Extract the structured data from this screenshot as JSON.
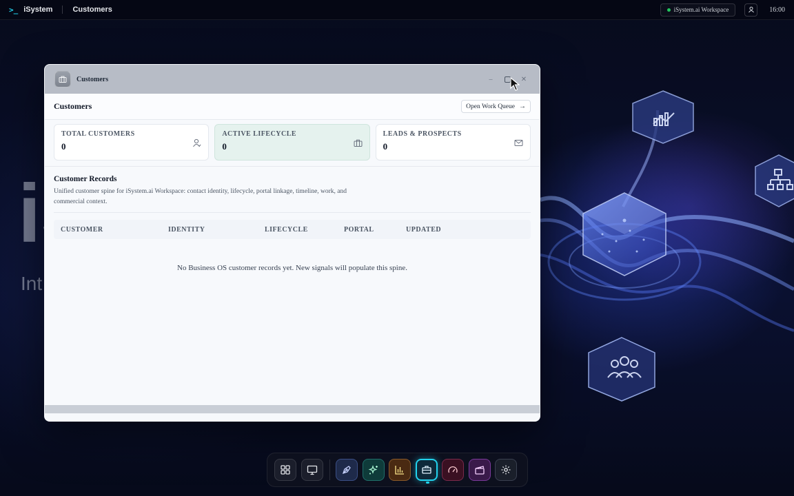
{
  "topbar": {
    "brand": "iSystem",
    "breadcrumb": "Customers",
    "workspace": "iSystem.ai Workspace",
    "clock": "16:00"
  },
  "background": {
    "big_text": "iS",
    "small_text": "Int"
  },
  "window": {
    "title": "Customers",
    "page_title": "Customers",
    "queue_button": "Open Work Queue",
    "stats": [
      {
        "label": "TOTAL CUSTOMERS",
        "value": "0",
        "icon": "user-icon"
      },
      {
        "label": "ACTIVE LIFECYCLE",
        "value": "0",
        "icon": "briefcase-icon"
      },
      {
        "label": "LEADS & PROSPECTS",
        "value": "0",
        "icon": "mail-icon"
      }
    ],
    "records": {
      "title": "Customer Records",
      "description": "Unified customer spine for iSystem.ai Workspace: contact identity, lifecycle, portal linkage, timeline, work, and commercial context.",
      "columns": [
        "CUSTOMER",
        "IDENTITY",
        "LIFECYCLE",
        "PORTAL",
        "UPDATED"
      ],
      "empty_message": "No Business OS customer records yet. New signals will populate this spine."
    }
  },
  "dock": {
    "items": [
      "grid-icon",
      "monitor-icon",
      "pen-icon",
      "sparkles-icon",
      "bar-chart-icon",
      "briefcase-icon",
      "gauge-icon",
      "clapperboard-icon",
      "gear-icon"
    ],
    "active": "briefcase-icon"
  },
  "colors": {
    "accent": "#22d3ee",
    "status_online": "#22c55e",
    "active_card": "#e5f2ee"
  }
}
